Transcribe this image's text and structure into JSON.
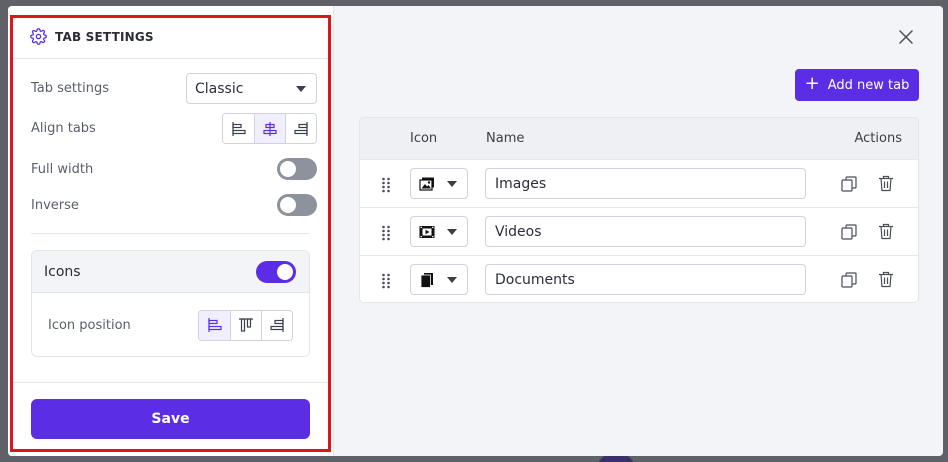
{
  "sidebar": {
    "header": "TAB SETTINGS",
    "rows": {
      "tab_settings_label": "Tab settings",
      "tab_settings_value": "Classic",
      "align_tabs_label": "Align tabs",
      "full_width_label": "Full width",
      "inverse_label": "Inverse"
    },
    "toggles": {
      "full_width": false,
      "inverse": false,
      "icons": true
    },
    "icons_card": {
      "title": "Icons",
      "icon_position_label": "Icon position"
    },
    "save_label": "Save"
  },
  "main": {
    "add_button_label": "Add new tab",
    "table": {
      "headers": {
        "icon": "Icon",
        "name": "Name",
        "actions": "Actions"
      },
      "rows": [
        {
          "icon": "image-icon",
          "name": "Images"
        },
        {
          "icon": "video-icon",
          "name": "Videos"
        },
        {
          "icon": "document-icon",
          "name": "Documents"
        }
      ]
    }
  },
  "colors": {
    "accent": "#5b2ee6",
    "highlight_border": "#e0141b",
    "toggle_off": "#8e929c"
  }
}
